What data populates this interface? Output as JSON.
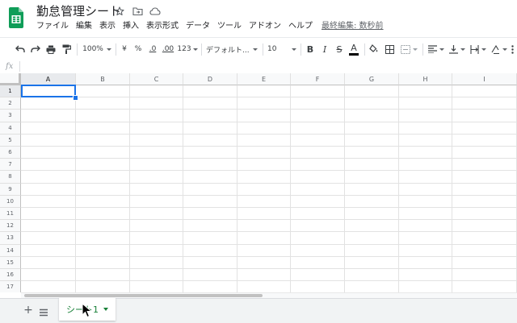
{
  "header": {
    "title": "勤怠管理シート",
    "last_edit": "最終編集: 数秒前",
    "icons": [
      "star-icon",
      "move-to-folder-icon",
      "cloud-status-icon"
    ]
  },
  "menu": [
    "ファイル",
    "編集",
    "表示",
    "挿入",
    "表示形式",
    "データ",
    "ツール",
    "アドオン",
    "ヘルプ"
  ],
  "toolbar": {
    "zoom": "100%",
    "currency": "¥",
    "percent": "%",
    "dec_decrease": ".0",
    "dec_increase": ".00",
    "more_formats": "123",
    "font": "デフォルト...",
    "font_size": "10",
    "bold": "B",
    "italic": "I",
    "strike": "S",
    "text_color": "A"
  },
  "formula": {
    "fx": "fx",
    "value": ""
  },
  "grid": {
    "columns": [
      "A",
      "B",
      "C",
      "D",
      "E",
      "F",
      "G",
      "H",
      "I"
    ],
    "rows": [
      "1",
      "2",
      "3",
      "4",
      "5",
      "6",
      "7",
      "8",
      "9",
      "10",
      "11",
      "12",
      "13",
      "14",
      "15",
      "16",
      "17"
    ],
    "selected_cell": "A1"
  },
  "sheets": [
    {
      "label": "シート1",
      "active": true
    }
  ],
  "colors": {
    "selection": "#1a73e8",
    "active_sheet": "#188038",
    "app_icon": "#0f9d58"
  }
}
